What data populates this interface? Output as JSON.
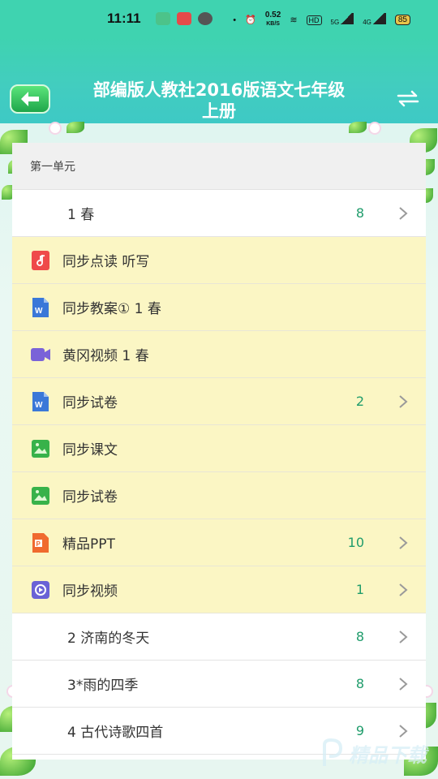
{
  "status_bar": {
    "time": "11:11",
    "network_speed": "0.52",
    "network_unit": "KB/S",
    "hd_badge": "HD",
    "signal1": "5G",
    "signal2": "4G",
    "battery": "85"
  },
  "header": {
    "title_line1": "部编版人教社2016版语文七年级",
    "title_line2": "上册",
    "back_icon": "back-arrow-icon",
    "switch_icon": "swap-icon"
  },
  "section": {
    "title": "第一单元"
  },
  "rows": [
    {
      "type": "lesson",
      "title": "1 春",
      "count": "8",
      "chevron": true
    },
    {
      "type": "resource",
      "icon": "music-file-icon",
      "icon_color": "#ef4a4a",
      "title": "同步点读 听写",
      "count": "",
      "chevron": false
    },
    {
      "type": "resource",
      "icon": "word-doc-icon",
      "icon_color": "#3a78d8",
      "title": "同步教案① 1 春",
      "count": "",
      "chevron": false
    },
    {
      "type": "resource",
      "icon": "video-file-icon",
      "icon_color": "#7a63d8",
      "title": "黄冈视频 1 春",
      "count": "",
      "chevron": false
    },
    {
      "type": "resource",
      "icon": "word-doc-icon",
      "icon_color": "#3a78d8",
      "title": "同步试卷",
      "count": "2",
      "chevron": true
    },
    {
      "type": "resource",
      "icon": "image-file-icon",
      "icon_color": "#38b24a",
      "title": "同步课文",
      "count": "",
      "chevron": false
    },
    {
      "type": "resource",
      "icon": "image-file-icon",
      "icon_color": "#38b24a",
      "title": "同步试卷",
      "count": "",
      "chevron": false
    },
    {
      "type": "resource",
      "icon": "ppt-file-icon",
      "icon_color": "#f06a2e",
      "title": "精品PPT",
      "count": "10",
      "chevron": true
    },
    {
      "type": "resource",
      "icon": "video-circle-icon",
      "icon_color": "#6a62d6",
      "title": "同步视频",
      "count": "1",
      "chevron": true
    },
    {
      "type": "lesson",
      "title": "2 济南的冬天",
      "count": "8",
      "chevron": true
    },
    {
      "type": "lesson",
      "title": "3*雨的四季",
      "count": "8",
      "chevron": true
    },
    {
      "type": "lesson",
      "title": "4 古代诗歌四首",
      "count": "9",
      "chevron": true
    }
  ],
  "watermark": {
    "text": "精品下载"
  },
  "colors": {
    "header_bg": "#3fd3b0",
    "resource_row_bg": "#fbf6c4",
    "count_color": "#1f9c6b"
  }
}
